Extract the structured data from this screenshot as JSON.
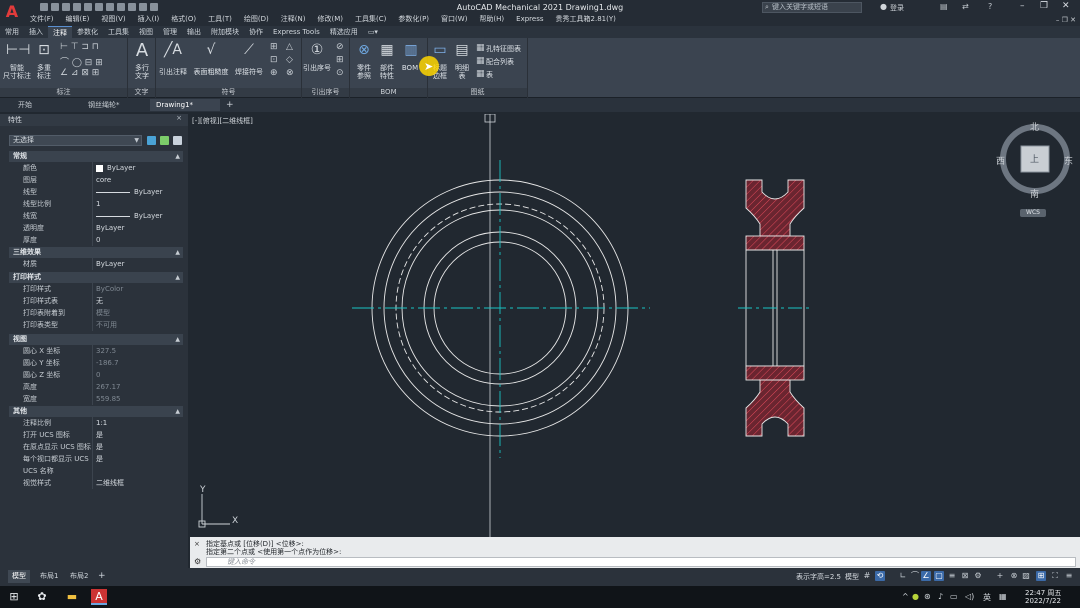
{
  "title_bar": {
    "app_logo": "A",
    "doc_title": "AutoCAD Mechanical 2021    Drawing1.dwg",
    "search_placeholder": "键入关键字或短语",
    "signin": "登录",
    "menu": [
      "文件(F)",
      "编辑(E)",
      "视图(V)",
      "插入(I)",
      "格式(O)",
      "工具(T)",
      "绘图(D)",
      "注释(N)",
      "修改(M)",
      "工具集(C)",
      "参数化(P)",
      "窗口(W)",
      "帮助(H)",
      "Express",
      "贵秀工具箱2.81(Y)"
    ]
  },
  "ribbon": {
    "tabs": [
      "常用",
      "插入",
      "注释",
      "参数化",
      "工具集",
      "视图",
      "管理",
      "输出",
      "附加模块",
      "协作",
      "Express Tools",
      "精选应用"
    ],
    "active_tab": "注释",
    "panels": {
      "dimension": {
        "title": "标注",
        "smart": "智能\n尺寸标注",
        "multi": "多重\n标注"
      },
      "text": {
        "title": "文字",
        "mtext": "多行\n文字"
      },
      "symbol": {
        "title": "符号",
        "leader": "引出注释",
        "surface": "表面粗糙度",
        "weld": "焊接符号"
      },
      "balloon": {
        "title": "引出序号",
        "label": "引出序号"
      },
      "bom": {
        "title": "BOM",
        "part_ref": "零件\n参照",
        "part_props": "部件\n特性",
        "bom": "BOM"
      },
      "drawing": {
        "title": "图纸",
        "title_border": "标题\n边框",
        "revision": "明细\n表",
        "hole_chart": "孔特征图表",
        "fits_list": "配合列表",
        "table": "表"
      }
    }
  },
  "file_tabs": {
    "start": "开始",
    "tab1": "钢丝绳轮*",
    "tab2": "Drawing1*"
  },
  "properties": {
    "header": "特性",
    "selection": "无选择",
    "sections": {
      "general": {
        "title": "常规",
        "rows": [
          {
            "label": "颜色",
            "value": "ByLayer"
          },
          {
            "label": "图层",
            "value": "core"
          },
          {
            "label": "线型",
            "value": "ByLayer"
          },
          {
            "label": "线型比例",
            "value": "1"
          },
          {
            "label": "线宽",
            "value": "ByLayer"
          },
          {
            "label": "透明度",
            "value": "ByLayer"
          },
          {
            "label": "厚度",
            "value": "0"
          }
        ]
      },
      "effects3d": {
        "title": "三维效果",
        "rows": [
          {
            "label": "材质",
            "value": "ByLayer"
          }
        ]
      },
      "plot": {
        "title": "打印样式",
        "rows": [
          {
            "label": "打印样式",
            "value": "ByColor"
          },
          {
            "label": "打印样式表",
            "value": "无"
          },
          {
            "label": "打印表附着到",
            "value": "模型"
          },
          {
            "label": "打印表类型",
            "value": "不可用"
          }
        ]
      },
      "view": {
        "title": "视图",
        "rows": [
          {
            "label": "圆心 X 坐标",
            "value": "327.5"
          },
          {
            "label": "圆心 Y 坐标",
            "value": "-186.7"
          },
          {
            "label": "圆心 Z 坐标",
            "value": "0"
          },
          {
            "label": "高度",
            "value": "267.17"
          },
          {
            "label": "宽度",
            "value": "559.85"
          }
        ]
      },
      "misc": {
        "title": "其他",
        "rows": [
          {
            "label": "注释比例",
            "value": "1:1"
          },
          {
            "label": "打开 UCS 图标",
            "value": "是"
          },
          {
            "label": "在原点显示 UCS 图标",
            "value": "是"
          },
          {
            "label": "每个视口都显示 UCS",
            "value": "是"
          },
          {
            "label": "UCS 名称",
            "value": ""
          },
          {
            "label": "视觉样式",
            "value": "二维线框"
          }
        ]
      }
    }
  },
  "viewport": {
    "label": "[-][俯视][二维线框]",
    "viewcube": {
      "north": "北",
      "south": "南",
      "east": "东",
      "west": "西",
      "face": "上",
      "ucs": "WCS"
    },
    "ucs_icon": {
      "x": "X",
      "y": "Y"
    },
    "colors": {
      "geometry": "#e8e8e8",
      "centerline": "#19c3c3",
      "hatch": "#d04050",
      "hatch_fill": "#7a2a35"
    }
  },
  "command_line": {
    "history": [
      "指定基点或 [位移(D)] <位移>:",
      "指定第二个点或 <使用第一个点作为位移>:"
    ],
    "placeholder": "键入命令"
  },
  "layout_tabs": [
    "模型",
    "布局1",
    "布局2"
  ],
  "status_bar": {
    "annotation": "表示字高=2.5",
    "model": "模型",
    "language": "英"
  },
  "taskbar": {
    "time": "22:47 周五",
    "date": "2022/7/22",
    "ime": "英"
  }
}
